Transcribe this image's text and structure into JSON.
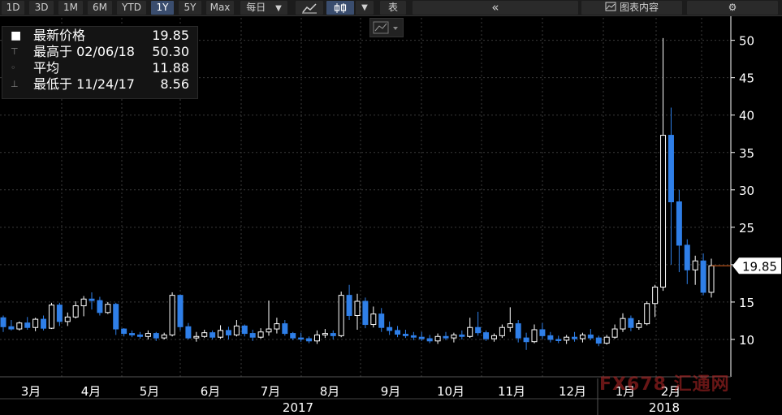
{
  "toolbar": {
    "periods": [
      "1D",
      "3D",
      "1M",
      "6M",
      "YTD",
      "1Y",
      "5Y",
      "Max"
    ],
    "active_period": "1Y",
    "interval": "每日",
    "interval_arrow": "▼",
    "chart_type_arrow": "▼",
    "table_label": "表",
    "collapse_glyph": "«",
    "chart_content_label": "图表内容",
    "settings_glyph": "⚙"
  },
  "legend": {
    "last_price_label": "最新价格",
    "last_price": "19.85",
    "high_label": "最高于 02/06/18",
    "high_value": "50.30",
    "avg_label": "平均",
    "avg_value": "11.88",
    "low_label": "最低于 11/24/17",
    "low_value": "8.56"
  },
  "watermark": "FX678 汇通网",
  "colors": {
    "up": "#ffffff",
    "down": "#2f7fe8",
    "axis": "#ffffff",
    "grid": "#3a3a3a",
    "last_price_line": "#e0641e",
    "accent": "#3a4d6e"
  },
  "chart_data": {
    "type": "candlestick",
    "ylim": [
      5,
      53
    ],
    "y_ticks": [
      10,
      15,
      20,
      25,
      30,
      35,
      40,
      45,
      50
    ],
    "last_price": 19.85,
    "last_price_label": "19.85",
    "month_ticks": [
      "3月",
      "4月",
      "5月",
      "6月",
      "7月",
      "8月",
      "9月",
      "10月",
      "11月",
      "12月",
      "1月",
      "2月"
    ],
    "year_labels": [
      "2017",
      "2018"
    ],
    "grid": true,
    "legend_position": "top-left",
    "weekly_ohlc": [
      [
        12.9,
        13.2,
        11.0,
        11.7
      ],
      [
        11.7,
        12.6,
        11.2,
        11.4
      ],
      [
        11.4,
        12.4,
        11.2,
        12.2
      ],
      [
        12.2,
        13.0,
        11.3,
        11.6
      ],
      [
        11.6,
        12.9,
        11.1,
        12.7
      ],
      [
        12.7,
        13.2,
        11.2,
        11.5
      ],
      [
        11.5,
        14.9,
        11.4,
        14.6
      ],
      [
        14.6,
        14.9,
        11.8,
        12.4
      ],
      [
        12.4,
        13.6,
        11.8,
        13.0
      ],
      [
        13.0,
        15.1,
        12.8,
        14.5
      ],
      [
        14.5,
        15.8,
        13.1,
        15.4
      ],
      [
        15.4,
        16.3,
        14.0,
        15.2
      ],
      [
        15.2,
        15.7,
        13.2,
        13.6
      ],
      [
        13.6,
        15.0,
        13.4,
        14.7
      ],
      [
        14.7,
        14.9,
        10.6,
        11.4
      ],
      [
        11.4,
        11.5,
        10.4,
        10.8
      ],
      [
        10.8,
        11.2,
        10.3,
        10.6
      ],
      [
        10.6,
        11.0,
        10.1,
        10.4
      ],
      [
        10.4,
        11.2,
        10.0,
        10.8
      ],
      [
        10.8,
        11.0,
        9.8,
        10.2
      ],
      [
        10.2,
        10.9,
        10.0,
        10.6
      ],
      [
        10.6,
        16.3,
        10.4,
        15.9
      ],
      [
        15.9,
        16.0,
        11.2,
        11.7
      ],
      [
        11.7,
        12.2,
        10.0,
        10.2
      ],
      [
        10.2,
        11.0,
        9.7,
        10.4
      ],
      [
        10.4,
        11.3,
        10.2,
        10.9
      ],
      [
        10.9,
        11.2,
        10.0,
        10.3
      ],
      [
        10.3,
        11.9,
        10.1,
        11.2
      ],
      [
        11.2,
        11.7,
        10.0,
        10.6
      ],
      [
        10.6,
        12.6,
        10.4,
        11.8
      ],
      [
        11.8,
        12.0,
        10.4,
        10.8
      ],
      [
        10.8,
        11.3,
        9.8,
        10.3
      ],
      [
        10.3,
        11.5,
        10.1,
        11.0
      ],
      [
        11.0,
        15.2,
        10.5,
        11.4
      ],
      [
        11.4,
        12.9,
        10.8,
        12.1
      ],
      [
        12.1,
        12.6,
        10.5,
        10.8
      ],
      [
        10.8,
        11.0,
        9.9,
        10.2
      ],
      [
        10.2,
        10.9,
        9.7,
        10.1
      ],
      [
        10.1,
        10.4,
        9.5,
        9.8
      ],
      [
        9.8,
        11.2,
        9.4,
        10.6
      ],
      [
        10.6,
        11.4,
        10.2,
        10.8
      ],
      [
        10.8,
        11.2,
        10.0,
        10.5
      ],
      [
        10.5,
        16.4,
        10.3,
        15.9
      ],
      [
        15.9,
        17.3,
        12.6,
        13.2
      ],
      [
        13.2,
        16.1,
        11.3,
        15.1
      ],
      [
        15.1,
        15.6,
        11.5,
        12.0
      ],
      [
        12.0,
        14.4,
        11.6,
        13.4
      ],
      [
        13.4,
        14.2,
        11.0,
        11.6
      ],
      [
        11.6,
        12.4,
        10.6,
        11.2
      ],
      [
        11.2,
        11.8,
        10.3,
        10.7
      ],
      [
        10.7,
        11.3,
        10.2,
        10.5
      ],
      [
        10.5,
        11.0,
        9.9,
        10.3
      ],
      [
        10.3,
        11.0,
        9.8,
        10.1
      ],
      [
        10.1,
        10.6,
        9.5,
        9.8
      ],
      [
        9.8,
        10.8,
        9.4,
        10.4
      ],
      [
        10.4,
        11.0,
        9.9,
        10.2
      ],
      [
        10.2,
        10.9,
        9.6,
        10.6
      ],
      [
        10.6,
        11.2,
        10.0,
        10.4
      ],
      [
        10.4,
        12.9,
        10.2,
        11.6
      ],
      [
        11.6,
        13.7,
        10.5,
        10.9
      ],
      [
        10.9,
        11.2,
        9.8,
        10.1
      ],
      [
        10.1,
        10.8,
        9.7,
        10.5
      ],
      [
        10.5,
        12.0,
        10.2,
        11.6
      ],
      [
        11.6,
        14.3,
        11.0,
        12.1
      ],
      [
        12.1,
        12.6,
        9.6,
        10.2
      ],
      [
        10.2,
        10.9,
        8.6,
        9.7
      ],
      [
        9.7,
        12.0,
        9.5,
        11.3
      ],
      [
        11.3,
        12.2,
        10.1,
        10.5
      ],
      [
        10.5,
        11.0,
        9.6,
        10.0
      ],
      [
        10.0,
        10.5,
        9.5,
        9.9
      ],
      [
        9.9,
        10.6,
        9.4,
        10.3
      ],
      [
        10.3,
        11.0,
        9.7,
        10.1
      ],
      [
        10.1,
        10.9,
        9.6,
        10.6
      ],
      [
        10.6,
        11.4,
        9.9,
        10.2
      ],
      [
        10.2,
        10.5,
        9.1,
        9.5
      ],
      [
        9.5,
        10.6,
        9.3,
        10.3
      ],
      [
        10.3,
        12.0,
        10.1,
        11.4
      ],
      [
        11.4,
        13.5,
        11.0,
        12.8
      ],
      [
        12.8,
        13.2,
        11.1,
        11.6
      ],
      [
        11.6,
        12.6,
        11.3,
        12.1
      ],
      [
        12.1,
        15.1,
        11.9,
        14.8
      ],
      [
        14.8,
        17.3,
        13.0,
        17.0
      ],
      [
        17.0,
        50.3,
        16.5,
        37.3
      ],
      [
        37.3,
        41.0,
        20.0,
        28.4
      ],
      [
        28.4,
        30.0,
        19.0,
        22.6
      ],
      [
        22.6,
        23.4,
        17.4,
        19.3
      ],
      [
        19.3,
        21.2,
        17.3,
        20.5
      ],
      [
        20.5,
        21.5,
        15.9,
        16.3
      ],
      [
        16.3,
        20.8,
        15.6,
        19.85
      ]
    ]
  }
}
